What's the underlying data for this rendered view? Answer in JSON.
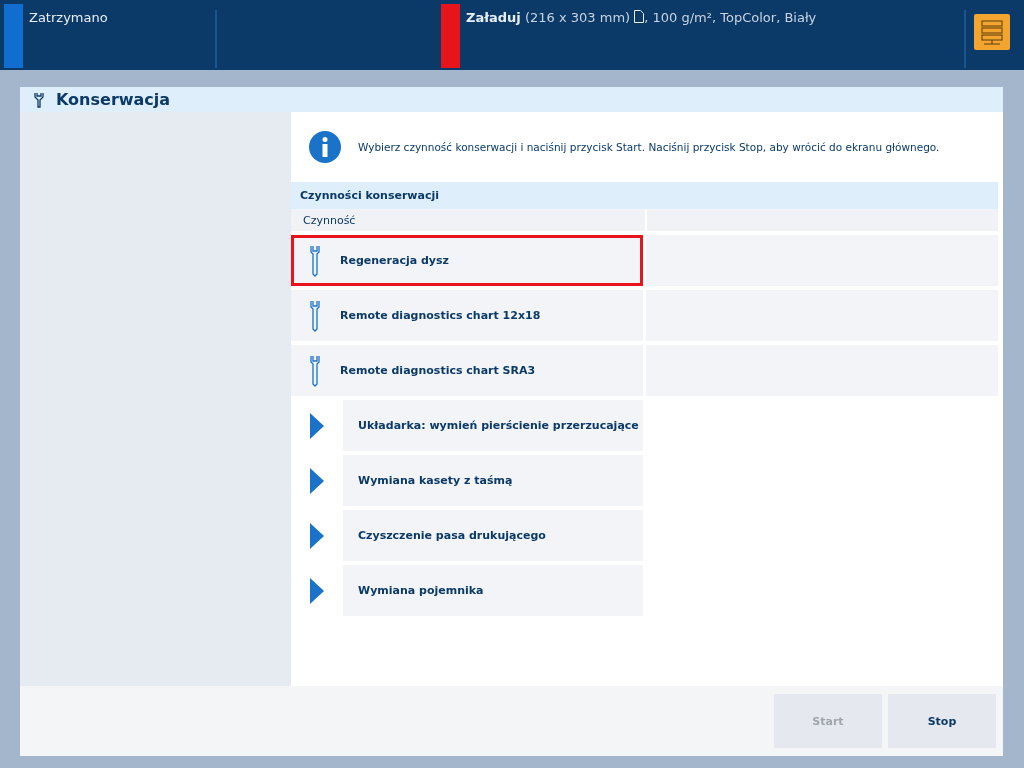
{
  "status_bar": {
    "state": "Zatrzymano",
    "load_label": "Załaduj",
    "load_detail": "(216 x 303 mm)",
    "load_media": ", 100 g/m², TopColor, Biały"
  },
  "dialog": {
    "title": "Konserwacja",
    "info": "Wybierz czynność konserwacji i naciśnij przycisk Start. Naciśnij przycisk Stop, aby wrócić do ekranu głównego.",
    "section": "Czynności konserwacji",
    "column_1": "Czynność",
    "rows": [
      {
        "kind": "action",
        "label": "Regeneracja dysz",
        "selected": true
      },
      {
        "kind": "action",
        "label": "Remote diagnostics chart 12x18",
        "selected": false
      },
      {
        "kind": "action",
        "label": "Remote diagnostics chart SRA3",
        "selected": false
      },
      {
        "kind": "procedure",
        "label": "Układarka: wymień pierścienie przerzucające",
        "selected": false
      },
      {
        "kind": "procedure",
        "label": "Wymiana kasety z taśmą",
        "selected": false
      },
      {
        "kind": "procedure",
        "label": "Czyszczenie pasa drukującego",
        "selected": false
      },
      {
        "kind": "procedure",
        "label": "Wymiana pojemnika",
        "selected": false
      }
    ],
    "buttons": [
      {
        "label": "Start",
        "disabled": true
      },
      {
        "label": "Stop",
        "disabled": false
      }
    ]
  }
}
